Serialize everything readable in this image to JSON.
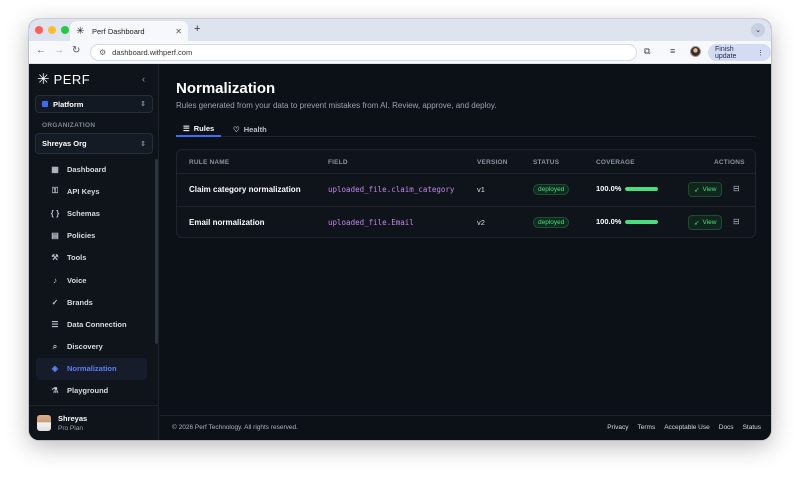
{
  "browser": {
    "tab_title": "Perf Dashboard",
    "url": "dashboard.withperf.com",
    "finish_update_label": "Finish update",
    "traffic_light_colors": [
      "#ff5f57",
      "#febc2e",
      "#28c840"
    ]
  },
  "sidebar": {
    "logo_text": "PERF",
    "workspace": "Platform",
    "org_label": "ORGANIZATION",
    "org_name": "Shreyas Org",
    "items": [
      {
        "label": "Dashboard",
        "icon": "dashboard-icon",
        "glyph": "▦"
      },
      {
        "label": "API Keys",
        "icon": "key-icon",
        "glyph": "⚿"
      },
      {
        "label": "Schemas",
        "icon": "braces-icon",
        "glyph": "{ }"
      },
      {
        "label": "Policies",
        "icon": "document-icon",
        "glyph": "▤"
      },
      {
        "label": "Tools",
        "icon": "wrench-icon",
        "glyph": "⚒"
      },
      {
        "label": "Voice",
        "icon": "microphone-icon",
        "glyph": "♪"
      },
      {
        "label": "Brands",
        "icon": "badge-check-icon",
        "glyph": "✓"
      },
      {
        "label": "Data Connection",
        "icon": "database-icon",
        "glyph": "☰"
      },
      {
        "label": "Discovery",
        "icon": "search-icon",
        "glyph": "⌕"
      },
      {
        "label": "Normalization",
        "icon": "layers-icon",
        "glyph": "◈"
      },
      {
        "label": "Playground",
        "icon": "flask-icon",
        "glyph": "⚗"
      }
    ],
    "active_item": "Normalization",
    "user": {
      "name": "Shreyas",
      "plan": "Pro Plan"
    }
  },
  "main": {
    "title": "Normalization",
    "subtitle": "Rules generated from your data to prevent mistakes from AI. Review, approve, and deploy.",
    "tabs": [
      {
        "label": "Rules",
        "icon": "list-icon",
        "active": true
      },
      {
        "label": "Health",
        "icon": "heart-pulse-icon",
        "active": false
      }
    ],
    "table": {
      "headers": {
        "rule_name": "RULE NAME",
        "field": "FIELD",
        "version": "VERSION",
        "status": "STATUS",
        "coverage": "COVERAGE",
        "actions": "ACTIONS"
      },
      "rows": [
        {
          "name": "Claim category normalization",
          "field": "uploaded_file.claim_category",
          "version": "v1",
          "status": "deployed",
          "coverage": "100.0%",
          "coverage_value": 1.0,
          "view_label": "View"
        },
        {
          "name": "Email normalization",
          "field": "uploaded_file.Email",
          "version": "v2",
          "status": "deployed",
          "coverage": "100.0%",
          "coverage_value": 1.0,
          "view_label": "View"
        }
      ]
    }
  },
  "footer": {
    "copyright": "© 2026 Perf Technology. All rights reserved.",
    "links": [
      "Privacy",
      "Terms",
      "Acceptable Use",
      "Docs",
      "Status"
    ]
  },
  "colors": {
    "accent": "#3b6ef5",
    "success": "#4ade80",
    "field_text": "#c087e6"
  }
}
